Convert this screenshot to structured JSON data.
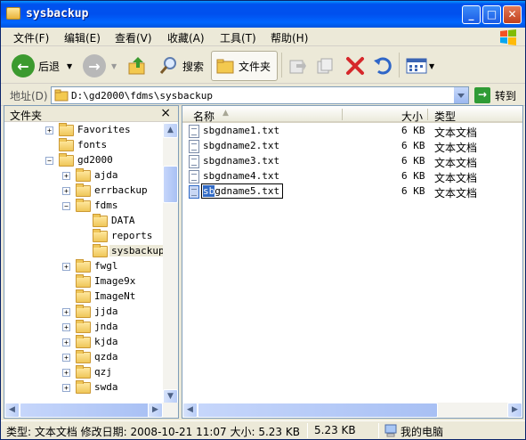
{
  "window": {
    "title": "sysbackup",
    "min": "_",
    "max": "□",
    "close": "✕"
  },
  "menu": [
    "文件(F)",
    "编辑(E)",
    "查看(V)",
    "收藏(A)",
    "工具(T)",
    "帮助(H)"
  ],
  "toolbar": {
    "back": "后退",
    "search": "搜索",
    "folders": "文件夹"
  },
  "address": {
    "label": "地址(D)",
    "value": "D:\\gd2000\\fdms\\sysbackup",
    "go": "转到"
  },
  "left": {
    "title": "文件夹",
    "close": "×",
    "tree": [
      {
        "label": "Favorites",
        "pm": "+"
      },
      {
        "label": "fonts",
        "pm": ""
      },
      {
        "label": "gd2000",
        "pm": "−"
      },
      {
        "label": "ajda",
        "pm": "+"
      },
      {
        "label": "errbackup",
        "pm": "+"
      },
      {
        "label": "fdms",
        "pm": "−"
      },
      {
        "label": "DATA",
        "pm": ""
      },
      {
        "label": "reports",
        "pm": ""
      },
      {
        "label": "sysbackup",
        "pm": ""
      },
      {
        "label": "fwgl",
        "pm": "+"
      },
      {
        "label": "Image9x",
        "pm": ""
      },
      {
        "label": "ImageNt",
        "pm": ""
      },
      {
        "label": "jjda",
        "pm": "+"
      },
      {
        "label": "jnda",
        "pm": "+"
      },
      {
        "label": "kjda",
        "pm": "+"
      },
      {
        "label": "qzda",
        "pm": "+"
      },
      {
        "label": "qzj",
        "pm": "+"
      },
      {
        "label": "swda",
        "pm": "+"
      }
    ]
  },
  "right": {
    "headers": {
      "name": "名称",
      "size": "大小",
      "type": "类型"
    },
    "files": [
      {
        "name": "sbgdname1.txt",
        "size": "6 KB",
        "type": "文本文档"
      },
      {
        "name": "sbgdname2.txt",
        "size": "6 KB",
        "type": "文本文档"
      },
      {
        "name": "sbgdname3.txt",
        "size": "6 KB",
        "type": "文本文档"
      },
      {
        "name": "sbgdname4.txt",
        "size": "6 KB",
        "type": "文本文档"
      },
      {
        "name": "sbgdname5.txt",
        "size": "6 KB",
        "type": "文本文档"
      }
    ],
    "edit": {
      "selected": "sb",
      "rest": "gdname5.txt"
    }
  },
  "status": {
    "info": "类型: 文本文档 修改日期: 2008-10-21 11:07 大小: 5.23 KB",
    "size": "5.23 KB",
    "zone": "我的电脑"
  }
}
